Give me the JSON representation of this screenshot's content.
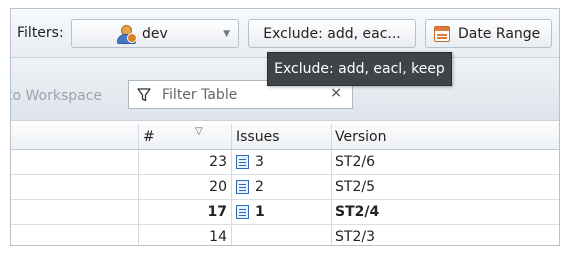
{
  "toolbar": {
    "filters_label": "Filters:",
    "user_filter": {
      "label": "dev",
      "icon": "user-group-icon"
    },
    "exclude_button": "Exclude: add, eac...",
    "date_range_button": "Date Range"
  },
  "tooltip": {
    "text": "Exclude: add, eacl, keep"
  },
  "secondary_toolbar": {
    "workspace_link": "to Workspace",
    "filter_table": {
      "placeholder": "Filter Table",
      "value": ""
    }
  },
  "table": {
    "columns": [
      "",
      "#",
      "Issues",
      "Version"
    ],
    "rows": [
      {
        "count": "23",
        "issues": "3",
        "version": "ST2/6",
        "bold": false
      },
      {
        "count": "20",
        "issues": "2",
        "version": "ST2/5",
        "bold": false
      },
      {
        "count": "17",
        "issues": "1",
        "version": "ST2/4",
        "bold": true
      },
      {
        "count": "14",
        "issues": "",
        "version": "ST2/3",
        "bold": false
      }
    ]
  },
  "colors": {
    "tooltip_bg": "#3f4448",
    "issue_icon": "#2f6db3",
    "date_icon": "#e07b39"
  }
}
